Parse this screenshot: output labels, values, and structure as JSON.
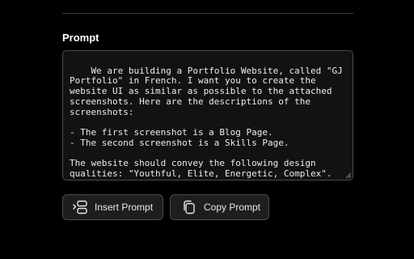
{
  "section": {
    "label": "Prompt"
  },
  "prompt": {
    "text": "We are building a Portfolio Website, called \"GJ Portfolio\" in French. I want you to create the website UI as similar as possible to the attached screenshots. Here are the descriptions of the screenshots:\n\n- The first screenshot is a Blog Page.\n- The second screenshot is a Skills Page.\n\nThe website should convey the following design qualities: \"Youthful, Elite, Energetic, Complex\"."
  },
  "buttons": {
    "insert": {
      "label": "Insert Prompt",
      "icon": "insert-icon"
    },
    "copy": {
      "label": "Copy Prompt",
      "icon": "copy-icon"
    }
  },
  "colors": {
    "background": "#000000",
    "box_background": "#121212",
    "border": "#4a4a4a",
    "button_background": "#1e1e1e"
  }
}
